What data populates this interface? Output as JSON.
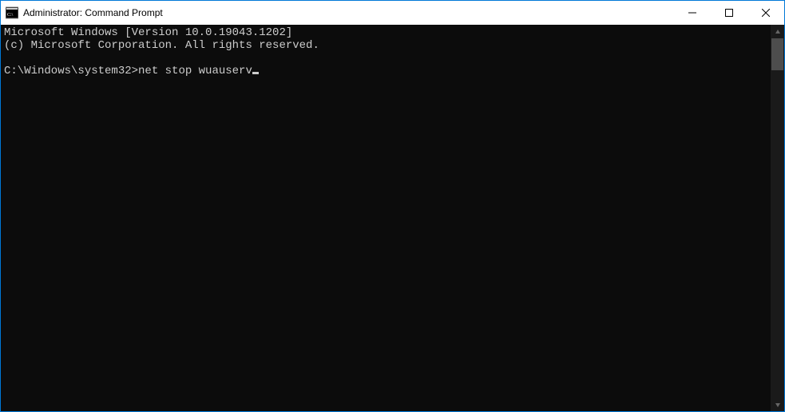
{
  "titlebar": {
    "title": "Administrator: Command Prompt"
  },
  "terminal": {
    "line1": "Microsoft Windows [Version 10.0.19043.1202]",
    "line2": "(c) Microsoft Corporation. All rights reserved.",
    "blank": "",
    "prompt": "C:\\Windows\\system32>",
    "command": "net stop wuauserv"
  }
}
